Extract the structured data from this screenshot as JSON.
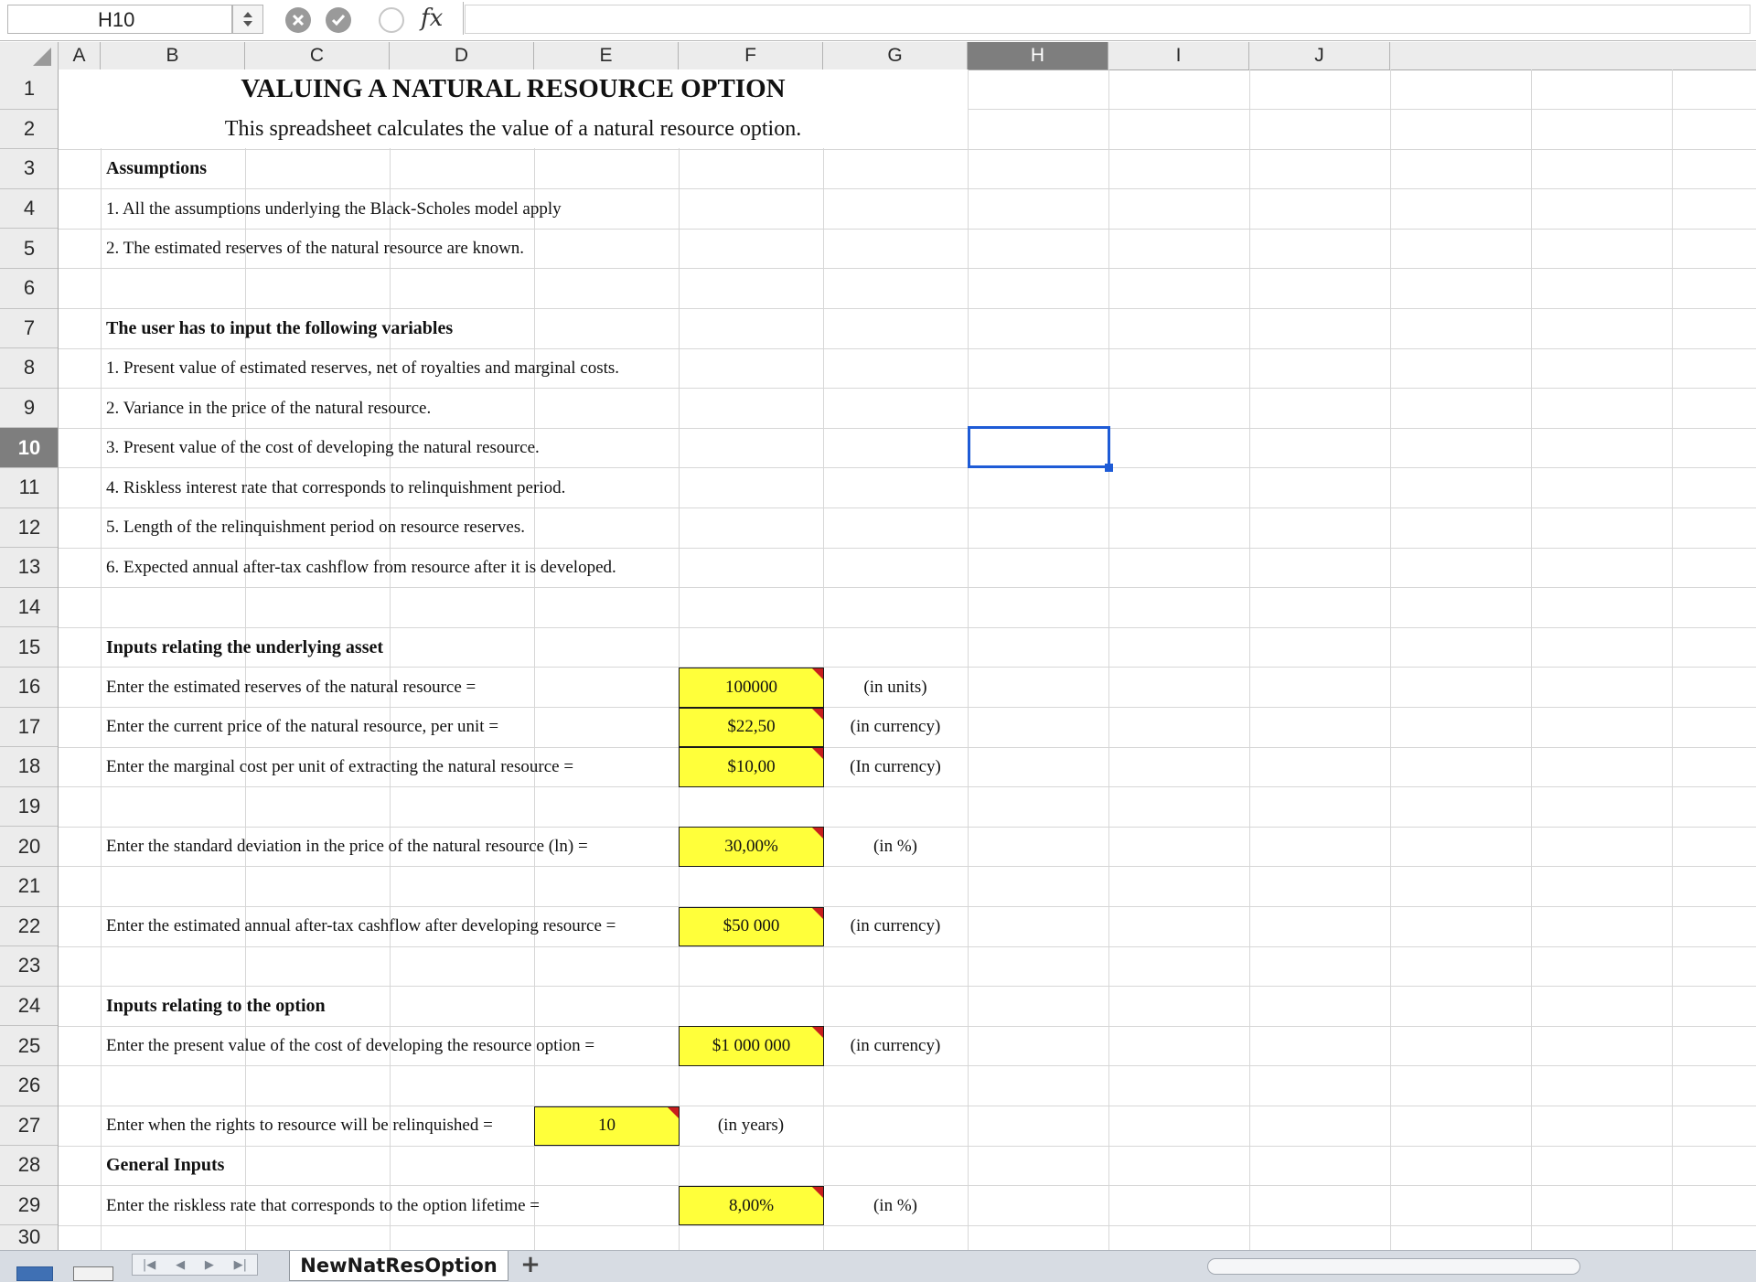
{
  "formula_bar": {
    "cell_ref": "H10",
    "fx_label": "fx",
    "formula": ""
  },
  "columns": [
    "A",
    "B",
    "C",
    "D",
    "E",
    "F",
    "G",
    "H",
    "I",
    "J"
  ],
  "selected_column": "H",
  "rows": [
    "1",
    "2",
    "3",
    "4",
    "5",
    "6",
    "7",
    "8",
    "9",
    "10",
    "11",
    "12",
    "13",
    "14",
    "15",
    "16",
    "17",
    "18",
    "19",
    "20",
    "21",
    "22",
    "23",
    "24",
    "25",
    "26",
    "27",
    "28",
    "29",
    "30"
  ],
  "selected_row": "10",
  "cells": {
    "title": "VALUING A NATURAL RESOURCE OPTION",
    "subtitle": "This spreadsheet calculates the value of a natural resource option.",
    "assumptions_head": "Assumptions",
    "assumption_1": "1. All the assumptions underlying the Black-Scholes model apply",
    "assumption_2": "2. The estimated reserves of the natural resource are known.",
    "inputs_list_head": "The user has to input the following variables",
    "var_1": "1. Present value of estimated reserves, net of royalties and marginal costs.",
    "var_2": "2. Variance in the price of the natural resource.",
    "var_3": "3. Present value of the cost of developing the natural resource.",
    "var_4": "4. Riskless interest rate that corresponds to relinquishment period.",
    "var_5": "5. Length of the relinquishment period on resource reserves.",
    "var_6": "6. Expected annual after-tax cashflow from resource after it is developed.",
    "underlying_head": "Inputs relating the underlying asset",
    "reserves_label": "Enter the estimated reserves of the natural resource =",
    "reserves_value": "100000",
    "reserves_unit": "(in units)",
    "price_label": "Enter the current price of the natural resource, per unit =",
    "price_value": "$22,50",
    "price_unit": "(in currency)",
    "cost_label": "Enter the marginal cost per unit of extracting the natural resource =",
    "cost_value": "$10,00",
    "cost_unit": "(In currency)",
    "sd_label": "Enter the standard deviation in the price of the natural resource (ln) =",
    "sd_value": "30,00%",
    "sd_unit": "(in %)",
    "cashflow_label": "Enter the estimated annual after-tax cashflow after developing resource =",
    "cashflow_value": "$50 000",
    "cashflow_unit": "(in currency)",
    "option_head": "Inputs relating to the option",
    "devcost_label": "Enter the present value of the cost of developing the resource option =",
    "devcost_value": "$1 000 000",
    "devcost_unit": "(in currency)",
    "relinquish_label": "Enter when the rights to resource will be relinquished =",
    "relinquish_value": "10",
    "relinquish_unit": "(in years)",
    "general_head": "General Inputs",
    "riskless_label": "Enter the riskless rate that corresponds to the option lifetime =",
    "riskless_value": "8,00%",
    "riskless_unit": "(in %)"
  },
  "sheet_tab": "NewNatResOption",
  "add_sheet": "+",
  "tab_nav": [
    "|◀",
    "◀",
    "▶",
    "▶|"
  ],
  "colors": {
    "input_fill": "#ffff3a",
    "selection": "#1e5bd6",
    "header_selected": "#7e7e7e"
  }
}
